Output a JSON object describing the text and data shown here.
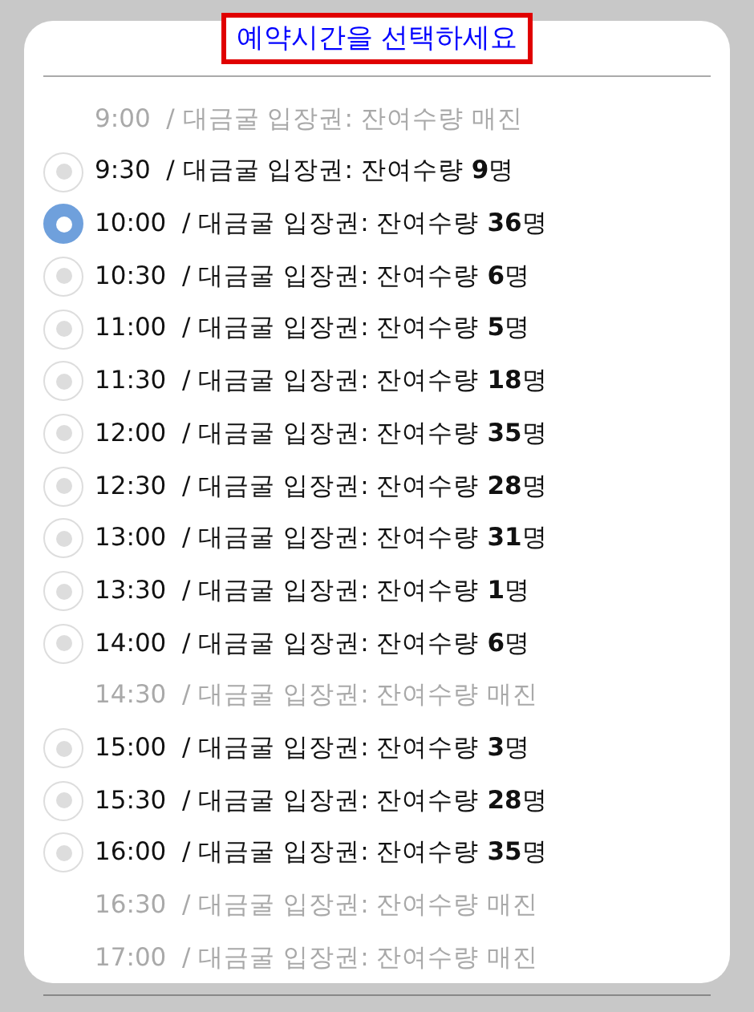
{
  "title": "예약시간을 선택하세요",
  "slots": [
    {
      "text": "9:00  / 대금굴 입장권: 잔여수량 매진",
      "disabled": true
    },
    {
      "text": "9:30  / 대금굴 입장권: 잔여수량 **9**명",
      "disabled": false,
      "selected": false
    },
    {
      "text": "10:00  / 대금굴 입장권: 잔여수량 **36**명",
      "disabled": false,
      "selected": true
    },
    {
      "text": "10:30  / 대금굴 입장권: 잔여수량 **6**명",
      "disabled": false,
      "selected": false
    },
    {
      "text": "11:00  / 대금굴 입장권: 잔여수량 **5**명",
      "disabled": false,
      "selected": false
    },
    {
      "text": "11:30  / 대금굴 입장권: 잔여수량 **18**명",
      "disabled": false,
      "selected": false
    },
    {
      "text": "12:00  / 대금굴 입장권: 잔여수량 **35**명",
      "disabled": false,
      "selected": false
    },
    {
      "text": "12:30  / 대금굴 입장권: 잔여수량 **28**명",
      "disabled": false,
      "selected": false
    },
    {
      "text": "13:00  / 대금굴 입장권: 잔여수량 **31**명",
      "disabled": false,
      "selected": false
    },
    {
      "text": "13:30  / 대금굴 입장권: 잔여수량 **1**명",
      "disabled": false,
      "selected": false
    },
    {
      "text": "14:00  / 대금굴 입장권: 잔여수량 **6**명",
      "disabled": false,
      "selected": false
    },
    {
      "text": "14:30  / 대금굴 입장권: 잔여수량 매진",
      "disabled": true
    },
    {
      "text": "15:00  / 대금굴 입장권: 잔여수량 **3**명",
      "disabled": false,
      "selected": false
    },
    {
      "text": "15:30  / 대금굴 입장권: 잔여수량 **28**명",
      "disabled": false,
      "selected": false
    },
    {
      "text": "16:00  / 대금굴 입장권: 잔여수량 **35**명",
      "disabled": false,
      "selected": false
    },
    {
      "text": "16:30  / 대금굴 입장권: 잔여수량 매진",
      "disabled": true
    },
    {
      "text": "17:00  / 대금굴 입장권: 잔여수량 매진",
      "disabled": true
    }
  ]
}
